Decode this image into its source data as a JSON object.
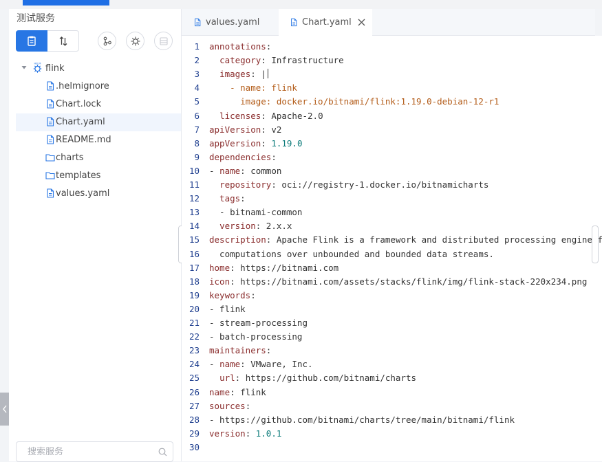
{
  "sidebar": {
    "title": "测试服务",
    "toolbar_icons": [
      "list-view-icon",
      "sort-icon",
      "git-branch-icon",
      "helm-icon",
      "disabled-table-icon"
    ],
    "tree": [
      {
        "label": "flink",
        "type": "helm-chart",
        "expanded": true
      },
      {
        "label": ".helmignore",
        "type": "file"
      },
      {
        "label": "Chart.lock",
        "type": "file"
      },
      {
        "label": "Chart.yaml",
        "type": "file",
        "selected": true
      },
      {
        "label": "README.md",
        "type": "file"
      },
      {
        "label": "charts",
        "type": "folder"
      },
      {
        "label": "templates",
        "type": "folder"
      },
      {
        "label": "values.yaml",
        "type": "file"
      }
    ],
    "search_placeholder": "搜索服务"
  },
  "tabs": [
    {
      "label": "values.yaml",
      "active": false
    },
    {
      "label": "Chart.yaml",
      "active": true,
      "closable": true
    }
  ],
  "editor": {
    "lines": [
      [
        {
          "t": "k",
          "v": "annotations"
        },
        {
          "t": "p",
          "v": ":"
        }
      ],
      [
        {
          "t": "p",
          "v": "  "
        },
        {
          "t": "k",
          "v": "category"
        },
        {
          "t": "p",
          "v": ": Infrastructure"
        }
      ],
      [
        {
          "t": "p",
          "v": "  "
        },
        {
          "t": "k",
          "v": "images"
        },
        {
          "t": "p",
          "v": ": |"
        }
      ],
      [
        {
          "t": "s",
          "v": "    - name: flink"
        }
      ],
      [
        {
          "t": "s",
          "v": "      image: docker.io/bitnami/flink:1.19.0-debian-12-r1"
        }
      ],
      [
        {
          "t": "p",
          "v": "  "
        },
        {
          "t": "k",
          "v": "licenses"
        },
        {
          "t": "p",
          "v": ": Apache-2.0"
        }
      ],
      [
        {
          "t": "k",
          "v": "apiVersion"
        },
        {
          "t": "p",
          "v": ": v2"
        }
      ],
      [
        {
          "t": "k",
          "v": "appVersion"
        },
        {
          "t": "p",
          "v": ": "
        },
        {
          "t": "vn",
          "v": "1.19.0"
        }
      ],
      [
        {
          "t": "k",
          "v": "dependencies"
        },
        {
          "t": "p",
          "v": ":"
        }
      ],
      [
        {
          "t": "p",
          "v": "- "
        },
        {
          "t": "k",
          "v": "name"
        },
        {
          "t": "p",
          "v": ": common"
        }
      ],
      [
        {
          "t": "p",
          "v": "  "
        },
        {
          "t": "k",
          "v": "repository"
        },
        {
          "t": "p",
          "v": ": oci://registry-1.docker.io/bitnamicharts"
        }
      ],
      [
        {
          "t": "p",
          "v": "  "
        },
        {
          "t": "k",
          "v": "tags"
        },
        {
          "t": "p",
          "v": ":"
        }
      ],
      [
        {
          "t": "p",
          "v": "  - bitnami-common"
        }
      ],
      [
        {
          "t": "p",
          "v": "  "
        },
        {
          "t": "k",
          "v": "version"
        },
        {
          "t": "p",
          "v": ": 2.x.x"
        }
      ],
      [
        {
          "t": "k",
          "v": "description"
        },
        {
          "t": "p",
          "v": ": Apache Flink is a framework and distributed processing engine for s"
        }
      ],
      [
        {
          "t": "p",
          "v": "  computations over unbounded and bounded data streams."
        }
      ],
      [
        {
          "t": "k",
          "v": "home"
        },
        {
          "t": "p",
          "v": ": https://bitnami.com"
        }
      ],
      [
        {
          "t": "k",
          "v": "icon"
        },
        {
          "t": "p",
          "v": ": https://bitnami.com/assets/stacks/flink/img/flink-stack-220x234.png"
        }
      ],
      [
        {
          "t": "k",
          "v": "keywords"
        },
        {
          "t": "p",
          "v": ":"
        }
      ],
      [
        {
          "t": "p",
          "v": "- flink"
        }
      ],
      [
        {
          "t": "p",
          "v": "- stream-processing"
        }
      ],
      [
        {
          "t": "p",
          "v": "- batch-processing"
        }
      ],
      [
        {
          "t": "k",
          "v": "maintainers"
        },
        {
          "t": "p",
          "v": ":"
        }
      ],
      [
        {
          "t": "p",
          "v": "- "
        },
        {
          "t": "k",
          "v": "name"
        },
        {
          "t": "p",
          "v": ": VMware, Inc."
        }
      ],
      [
        {
          "t": "p",
          "v": "  "
        },
        {
          "t": "k",
          "v": "url"
        },
        {
          "t": "p",
          "v": ": https://github.com/bitnami/charts"
        }
      ],
      [
        {
          "t": "k",
          "v": "name"
        },
        {
          "t": "p",
          "v": ": flink"
        }
      ],
      [
        {
          "t": "k",
          "v": "sources"
        },
        {
          "t": "p",
          "v": ":"
        }
      ],
      [
        {
          "t": "p",
          "v": "- https://github.com/bitnami/charts/tree/main/bitnami/flink"
        }
      ],
      [
        {
          "t": "k",
          "v": "version"
        },
        {
          "t": "p",
          "v": ": "
        },
        {
          "t": "vn",
          "v": "1.0.1"
        }
      ],
      []
    ]
  },
  "colors": {
    "accent": "#2776e4",
    "key": "#8a2d2d",
    "string_block": "#b25a16",
    "number": "#0c7b7a",
    "line_number": "#1f3f8f"
  }
}
